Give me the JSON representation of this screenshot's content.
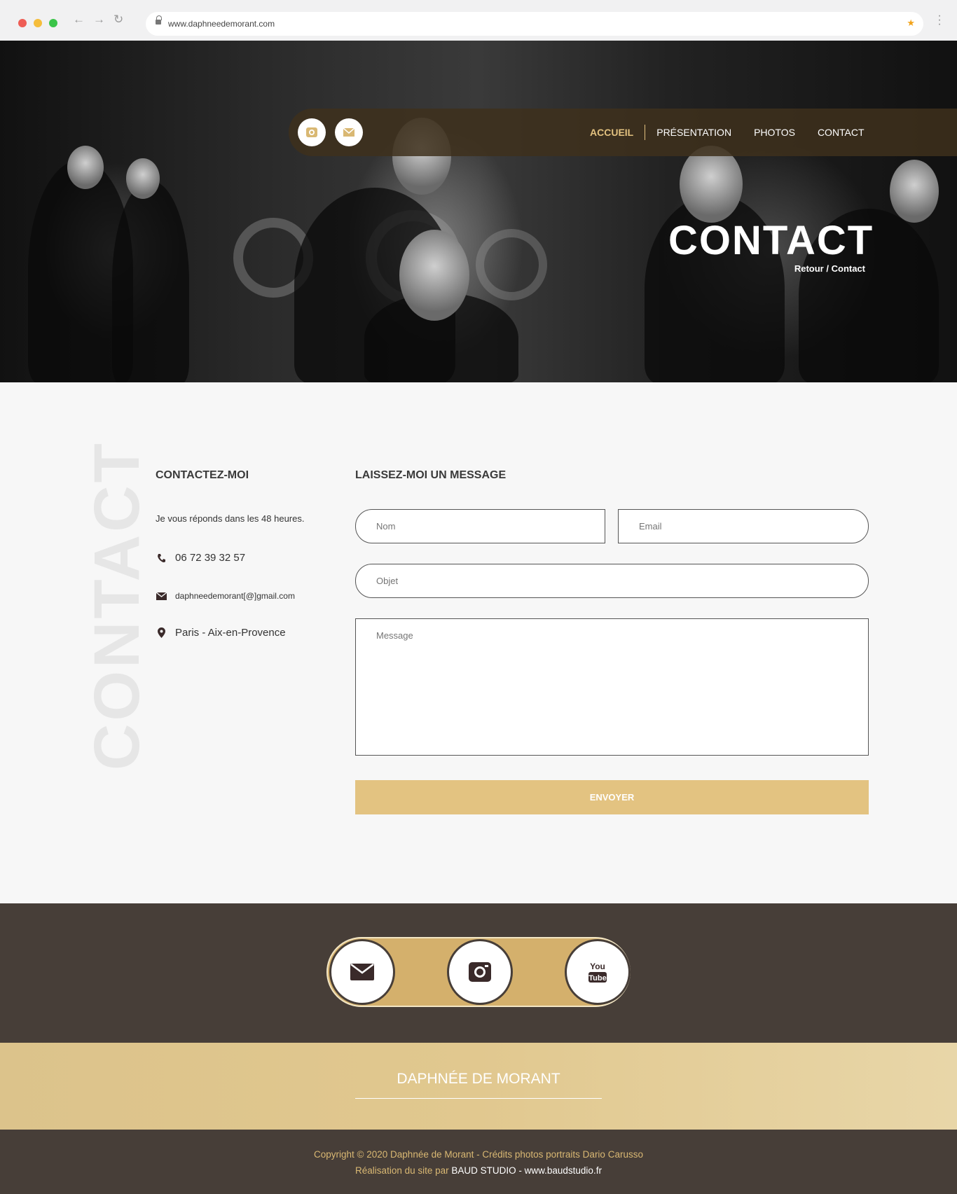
{
  "browser": {
    "url": "www.daphneedemorant.com"
  },
  "nav": {
    "items": [
      {
        "label": "ACCUEIL"
      },
      {
        "label": "PRÉSENTATION"
      },
      {
        "label": "PHOTOS"
      },
      {
        "label": "CONTACT"
      }
    ]
  },
  "hero": {
    "title": "CONTACT",
    "crumb_back": "Retour",
    "crumb_sep": "/",
    "crumb_current": "Contact"
  },
  "contact": {
    "watermark": "CONTACT",
    "heading": "CONTACTEZ-MOI",
    "intro": "Je vous réponds dans les 48 heures.",
    "phone": "06 72 39 32 57",
    "email": "daphneedemorant[@]gmail.com",
    "location": "Paris - Aix-en-Provence"
  },
  "form": {
    "heading": "LAISSEZ-MOI UN MESSAGE",
    "name_placeholder": "Nom",
    "email_placeholder": "Email",
    "subject_placeholder": "Objet",
    "message_placeholder": "Message",
    "submit_label": "ENVOYER"
  },
  "footer": {
    "brand": "DAPHNÉE DE MORANT",
    "copyright": "Copyright © 2020 Daphnée de Morant - Crédits photos portraits Dario Carusso",
    "credit_prefix": "Réalisation du site par ",
    "credit_studio": "BAUD STUDIO - www.baudstudio.fr"
  },
  "colors": {
    "gold": "#e3c381",
    "dark_brown": "#473e38",
    "nav_active": "#e2c17f"
  }
}
